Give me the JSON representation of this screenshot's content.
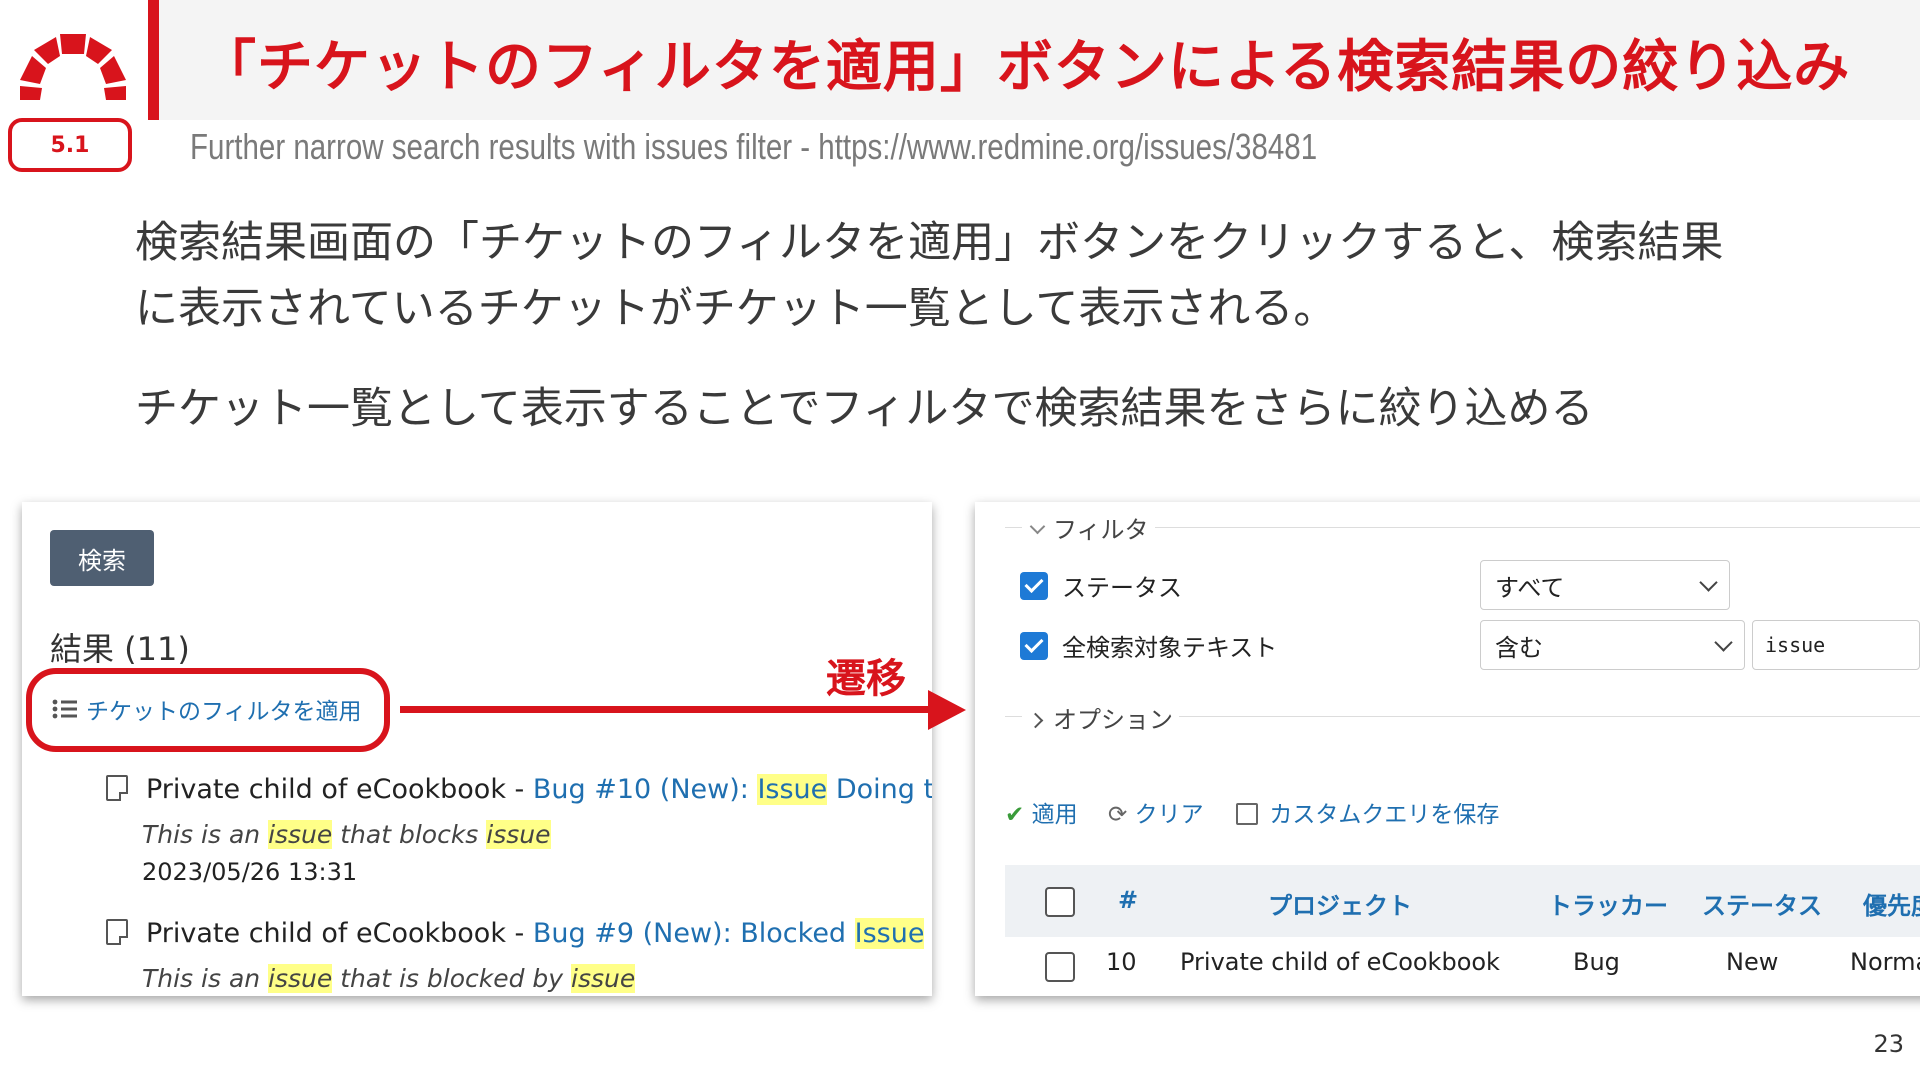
{
  "slide": {
    "title": "「チケットのフィルタを適用」ボタンによる検索結果の絞り込み",
    "section": "5.1",
    "subtitle": "Further narrow search results with issues filter - https://www.redmine.org/issues/38481",
    "body_line1": "検索結果画面の「チケットのフィルタを適用」ボタンをクリックすると、検索結果",
    "body_line2": "に表示されているチケットがチケット一覧として表示される。",
    "body_line3": "チケット一覧として表示することでフィルタで検索結果をさらに絞り込める",
    "page_number": "23",
    "transition_label": "遷移",
    "accent_color": "#d8141c"
  },
  "search_screen": {
    "search_button": "検索",
    "results_heading": "結果 (11)",
    "apply_filter_link": "チケットのフィルタを適用",
    "results": [
      {
        "project": "Private child of eCookbook",
        "separator": " - ",
        "issue_prefix": "Bug #10 (New): ",
        "issue_hl": "Issue",
        "issue_rest": " Doing the",
        "desc_parts": [
          "This is an ",
          "issue",
          " that blocks ",
          "issue"
        ],
        "datetime": "2023/05/26 13:31"
      },
      {
        "project": "Private child of eCookbook",
        "separator": " - ",
        "issue_prefix": "Bug #9 (New): Blocked ",
        "issue_hl": "Issue",
        "issue_rest": "",
        "desc_parts": [
          "This is an ",
          "issue",
          " that is blocked by ",
          "issue"
        ]
      }
    ]
  },
  "issues_screen": {
    "filter_legend": "フィルタ",
    "filters": [
      {
        "label": "ステータス",
        "checked": true,
        "operator": "すべて"
      },
      {
        "label": "全検索対象テキスト",
        "checked": true,
        "operator": "含む",
        "value": "issue"
      }
    ],
    "options_legend": "オプション",
    "actions": {
      "apply": "適用",
      "clear": "クリア",
      "save": "カスタムクエリを保存"
    },
    "table": {
      "headers": [
        "#",
        "プロジェクト",
        "トラッカー",
        "ステータス",
        "優先度"
      ],
      "rows": [
        {
          "id": "10",
          "project": "Private child of eCookbook",
          "tracker": "Bug",
          "status": "New",
          "priority": "Norma"
        }
      ]
    }
  }
}
